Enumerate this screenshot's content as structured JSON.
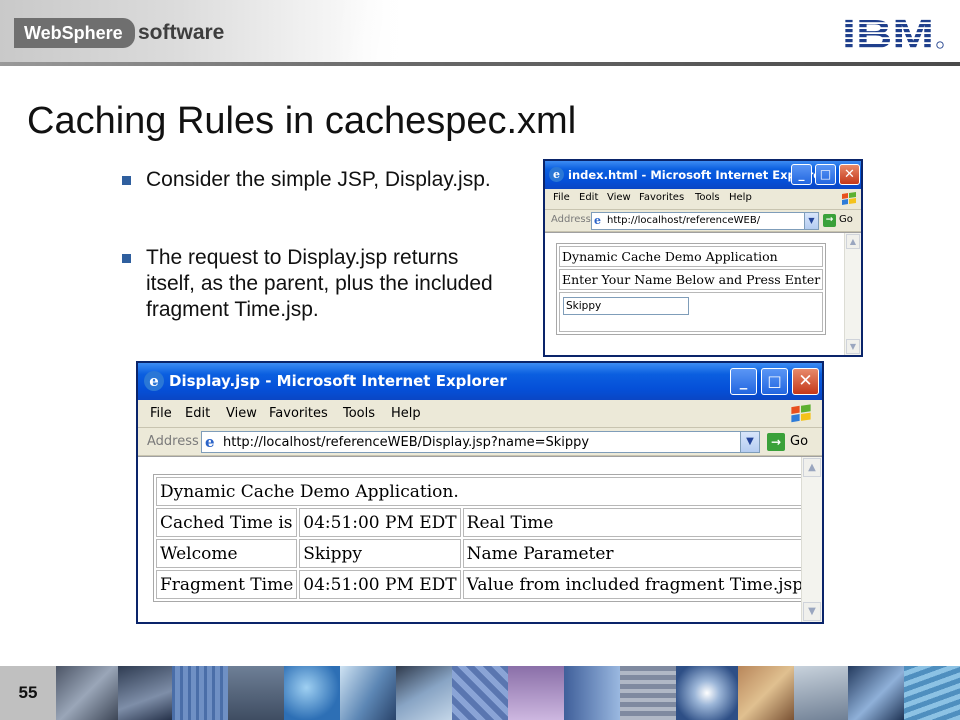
{
  "header": {
    "product_badge": "WebSphere",
    "product_suffix": "software",
    "logo": "IBM"
  },
  "slide": {
    "title": "Caching Rules in cachespec.xml",
    "bullets": [
      "Consider the simple JSP, Display.jsp.",
      "The request to Display.jsp returns itself, as the parent, plus the included fragment Time.jsp."
    ],
    "page_number": "55"
  },
  "window_index": {
    "title": "index.html - Microsoft Internet Explorer",
    "menu": [
      "File",
      "Edit",
      "View",
      "Favorites",
      "Tools",
      "Help"
    ],
    "address_label": "Address",
    "url": "http://localhost/referenceWEB/",
    "go_label": "Go",
    "page_rows": [
      "Dynamic Cache Demo Application",
      "Enter Your Name Below and Press Enter"
    ],
    "input_value": "Skippy"
  },
  "window_display": {
    "title": "Display.jsp - Microsoft Internet Explorer",
    "menu": [
      "File",
      "Edit",
      "View",
      "Favorites",
      "Tools",
      "Help"
    ],
    "address_label": "Address",
    "url": "http://localhost/referenceWEB/Display.jsp?name=Skippy",
    "go_label": "Go",
    "table_header": "Dynamic Cache Demo Application.",
    "rows": [
      [
        "Cached Time is",
        "04:51:00 PM EDT",
        "Real Time"
      ],
      [
        "Welcome",
        "Skippy",
        "Name Parameter"
      ],
      [
        "Fragment Time",
        "04:51:00 PM EDT",
        "Value from included fragment Time.jsp"
      ]
    ]
  },
  "icons": {
    "window_buttons": [
      "minimize-icon",
      "maximize-icon",
      "close-icon"
    ],
    "throbber": "windows-flag-icon",
    "page_icon": "ie-page-icon",
    "go": "go-arrow-icon"
  },
  "colors": {
    "titlebar_blue": "#0550d8",
    "bullet_blue": "#2f5f9e",
    "footer_gray": "#6b6b6b"
  }
}
